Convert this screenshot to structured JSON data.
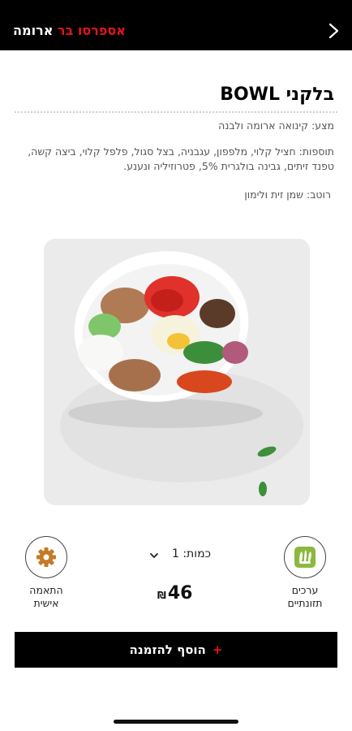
{
  "header": {
    "brand_red": "אספרסו בר",
    "brand_white": "ארומה",
    "back_icon": "chevron-right-icon",
    "background": "#000000",
    "accent": "#e3141f"
  },
  "product": {
    "title": "בלקני BOWL",
    "base": "מצע: קינואה ארומה ולבנה",
    "toppings": "תוספות: חציל קלוי, מלפפון, עגבניה, בצל סגול, פלפל קלוי, ביצה קשה, טפנד זיתים, גבינה בולגרית 5%, פטרוזיליה ונענע.",
    "sauce": "רוטב: שמן זית ולימון"
  },
  "actions": {
    "nutrition_icon": "wheat-icon",
    "nutrition_line1": "ערכים",
    "nutrition_line2": "תזונתיים",
    "custom_icon": "gear-icon",
    "custom_line1": "התאמה",
    "custom_line2": "אישית"
  },
  "order": {
    "quantity_label": "כמות: 1",
    "price": "46",
    "currency": "₪",
    "add_label": "הוסף להזמנה",
    "add_icon": "plus-icon"
  }
}
